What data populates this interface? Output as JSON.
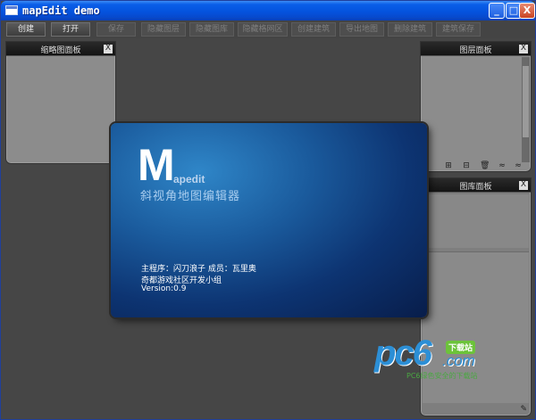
{
  "window": {
    "title": "mapEdit demo",
    "controls": {
      "minimize": "_",
      "maximize": "□",
      "close": "X"
    }
  },
  "toolbar": {
    "items": [
      {
        "label": "创建",
        "enabled": true
      },
      {
        "label": "打开",
        "enabled": true
      },
      {
        "label": "保存",
        "enabled": false
      },
      {
        "label": "隐藏图层",
        "enabled": false
      },
      {
        "label": "隐藏图库",
        "enabled": false
      },
      {
        "label": "隐藏格网区",
        "enabled": false
      },
      {
        "label": "创建建筑",
        "enabled": false
      },
      {
        "label": "导出地图",
        "enabled": false
      },
      {
        "label": "删除建筑",
        "enabled": false
      },
      {
        "label": "建筑保存",
        "enabled": false
      }
    ]
  },
  "panels": {
    "thumbnail": {
      "title": "缩略图面板",
      "close": "X"
    },
    "layers": {
      "title": "图层面板",
      "close": "X",
      "tools": [
        "⊞",
        "⊟",
        "🗑",
        "≈",
        "≈"
      ]
    },
    "library": {
      "title": "图库面板",
      "close": "X",
      "edit_icon": "✎"
    }
  },
  "splash": {
    "logo_initial": "M",
    "logo_rest": "apedit",
    "subtitle": "斜视角地图编辑器",
    "credits": [
      "主程序：闪刀浪子     成员：瓦里奥",
      "奇都游戏社区开发小组",
      "Version:0.9"
    ]
  },
  "watermark": {
    "brand": "pc6",
    "badge": "下载站",
    "domain": ".com",
    "slogan": "PC6绿色安全的下载站"
  },
  "colors": {
    "titlebar": "#0453de",
    "background": "#464646",
    "splash_accent": "#1a5a9c"
  }
}
